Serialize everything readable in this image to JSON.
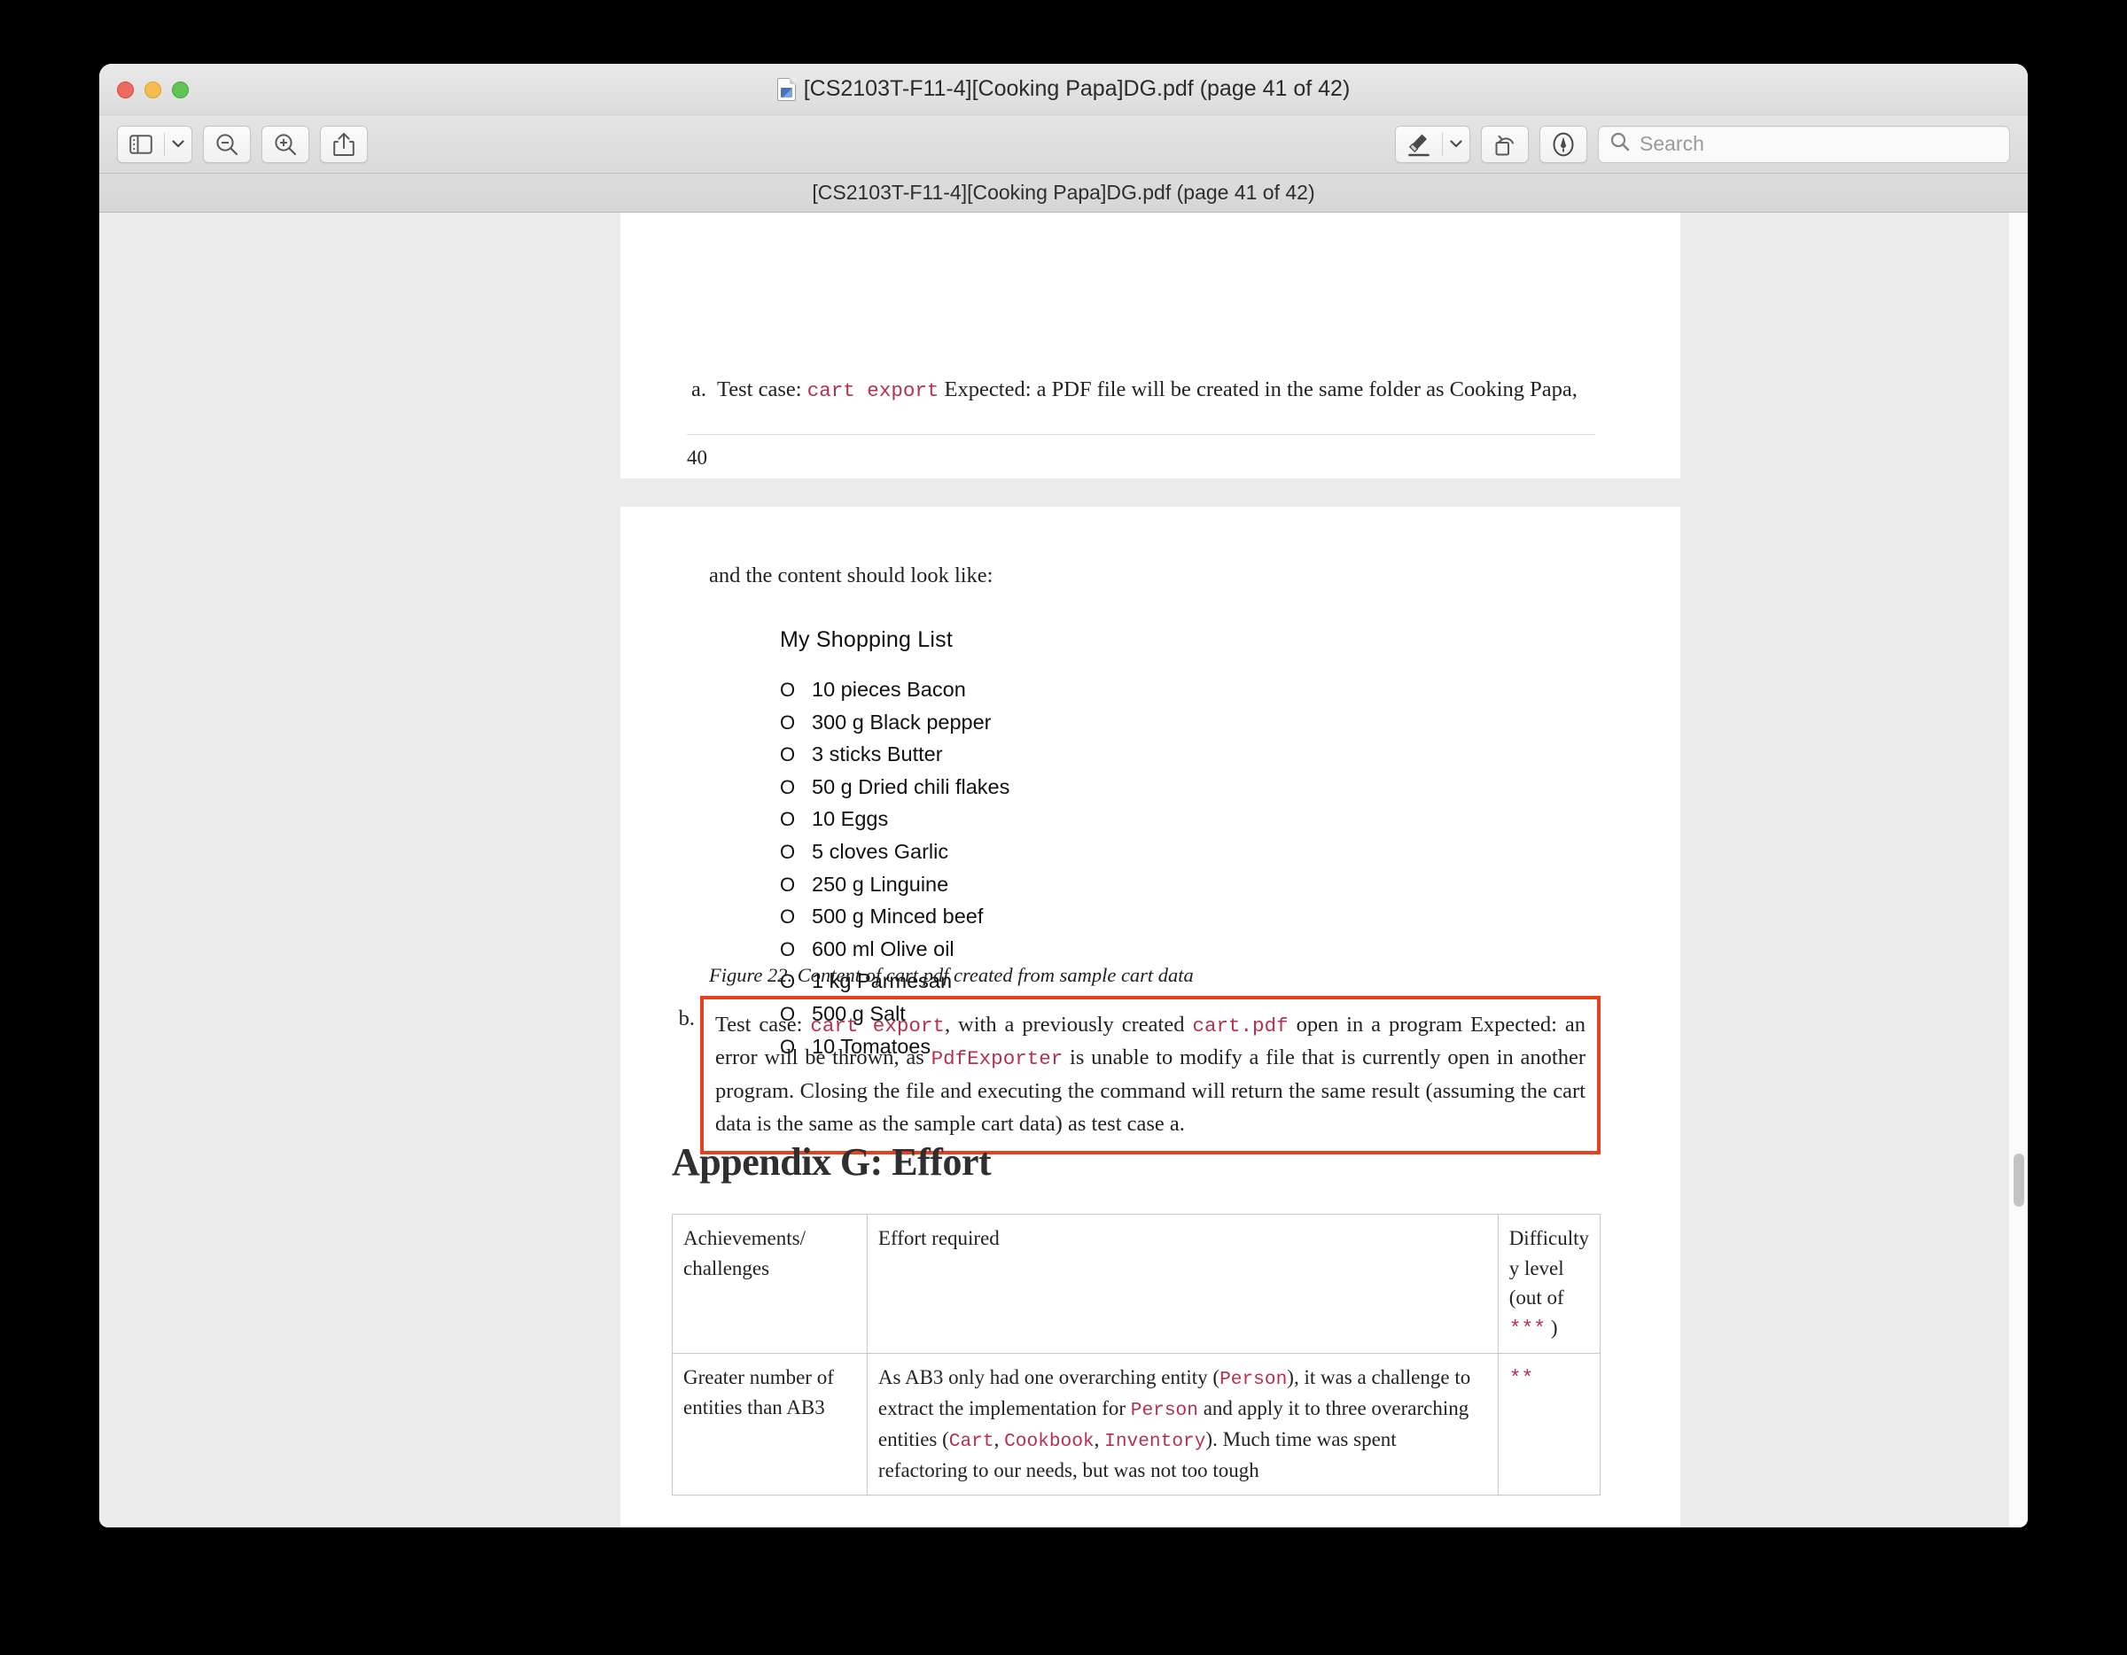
{
  "window": {
    "title": "[CS2103T-F11-4][Cooking Papa]DG.pdf (page 41 of 42)",
    "pathbar": "[CS2103T-F11-4][Cooking Papa]DG.pdf (page 41 of 42)"
  },
  "traffic_lights": {
    "close": "close",
    "minimize": "minimize",
    "maximize": "maximize"
  },
  "toolbar": {
    "sidebar_label": "Sidebar",
    "zoom_out_label": "Zoom Out",
    "zoom_in_label": "Zoom In",
    "share_label": "Share",
    "highlight_label": "Highlight",
    "highlight_menu_label": "Highlight options",
    "rotate_label": "Rotate",
    "markup_label": "Markup",
    "search_placeholder": "Search",
    "search_value": ""
  },
  "colors": {
    "annotation_box": "#e8401f",
    "code_text": "#b5314d",
    "page_background": "#ffffff",
    "canvas_background": "#ececec"
  },
  "page40": {
    "marker": "a.",
    "text_1": "Test case:",
    "code_1": "cart export",
    "text_2": "Expected: a PDF file will be created in the same folder as Cooking Papa,",
    "page_number": "40"
  },
  "page41": {
    "intro": "and the content should look like:",
    "figure": {
      "title": "My Shopping List",
      "bullet_glyph": "O",
      "items": [
        "10 pieces Bacon",
        "300 g Black pepper",
        "3 sticks Butter",
        "50 g Dried chili flakes",
        "10 Eggs",
        "5 cloves Garlic",
        "250 g Linguine",
        "500 g Minced beef",
        "600 ml Olive oil",
        "1 kg Parmesan",
        "500 g Salt",
        "10 Tomatoes"
      ],
      "caption": "Figure 22. Content of cart.pdf created from sample cart data"
    },
    "annotation": {
      "marker": "b.",
      "seg_1": "Test case: ",
      "code_1": "cart export",
      "seg_2": ", with a previously created ",
      "code_2": "cart.pdf",
      "seg_3": " open in a program Expected: an error will be thrown, as ",
      "code_3": "PdfExporter",
      "seg_4": " is unable to modify a file that is currently open in another program. Closing the file and executing the command will return the same result (assuming the cart data is the same as the sample cart data) as test case a."
    },
    "appendix_heading": "Appendix G: Effort",
    "table": {
      "headers": {
        "col_a": "Achievements/ challenges",
        "col_b": "Effort required",
        "col_c_pre": "Difficulty y level (out of ",
        "col_c_stars": "***",
        "col_c_post": " )"
      },
      "row_1": {
        "achievement": "Greater number of entities than AB3",
        "effort_seg_1": "As AB3 only had one overarching entity (",
        "effort_code_1": "Person",
        "effort_seg_2": "), it was a challenge to extract the implementation for ",
        "effort_code_2": "Person",
        "effort_seg_3": " and apply it to three overarching entities (",
        "effort_code_3": "Cart",
        "effort_sep_1": ", ",
        "effort_code_4": "Cookbook",
        "effort_sep_2": ", ",
        "effort_code_5": "Inventory",
        "effort_seg_4": "). Much time was spent refactoring to our needs, but was not too tough",
        "difficulty": "**"
      }
    }
  }
}
